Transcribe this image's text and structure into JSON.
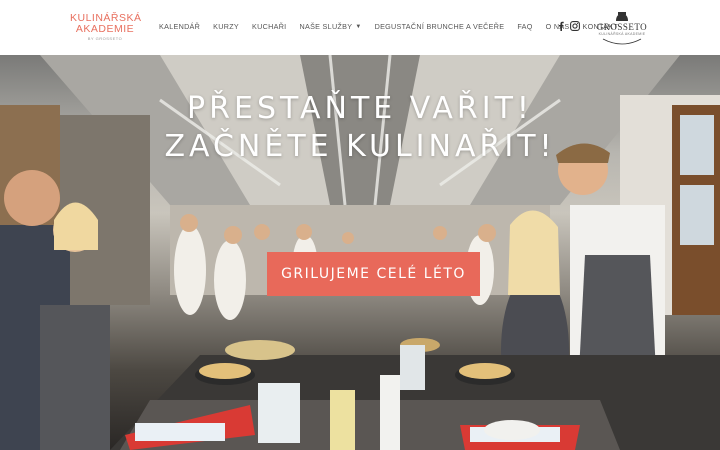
{
  "logo": {
    "line1": "KULINÁŘSKÁ",
    "line2": "AKADEMIE",
    "line3": "BY GROSSETO"
  },
  "nav": {
    "items": [
      "KALENDÁŘ",
      "KURZY",
      "KUCHAŘI",
      "NAŠE SLUŽBY",
      "DEGUSTAČNÍ BRUNCHE A VEČEŘE",
      "FAQ",
      "O NÁS",
      "KONTAKT"
    ]
  },
  "social": {
    "icons": [
      "facebook-icon",
      "instagram-icon"
    ]
  },
  "partner_logo": {
    "name": "GROSSETO",
    "sub": "KULINÁŘSKÁ AKADEMIE"
  },
  "hero": {
    "title_line1": "PŘESTAŇTE VAŘIT!",
    "title_line2": "ZAČNĚTE KULINAŘIT!",
    "cta_label": "GRILUJEME CELÉ LÉTO"
  },
  "colors": {
    "accent": "#e8695a",
    "logo": "#e8705f"
  }
}
